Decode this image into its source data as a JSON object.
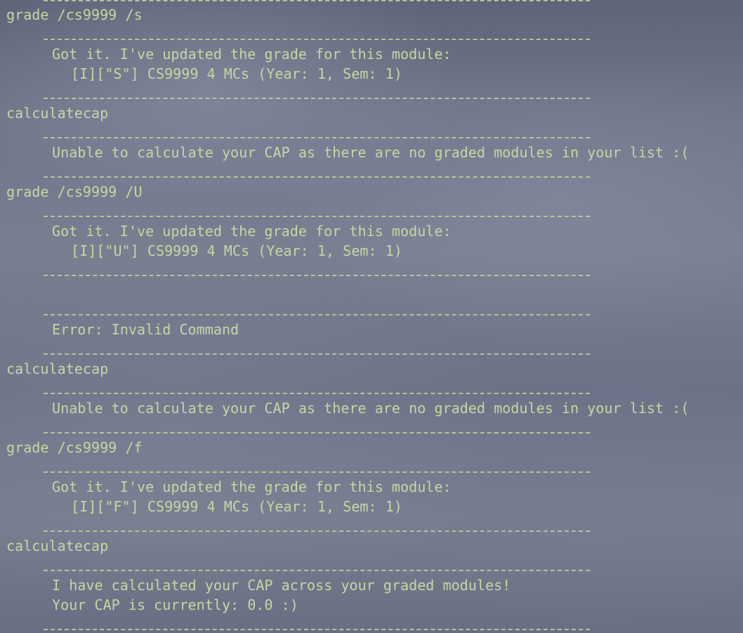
{
  "lines": [
    {
      "id": "l1",
      "kind": "command",
      "text": "grade /cs9999 /s"
    },
    {
      "id": "l2",
      "kind": "response",
      "text": "Got it. I've updated the grade for this module:"
    },
    {
      "id": "l3",
      "kind": "response-detail",
      "text": "[I][\"S\"] CS9999 4 MCs (Year: 1, Sem: 1)"
    },
    {
      "id": "l4",
      "kind": "command",
      "text": "calculatecap"
    },
    {
      "id": "l5",
      "kind": "response",
      "text": "Unable to calculate your CAP as there are no graded modules in your list :("
    },
    {
      "id": "l6",
      "kind": "command",
      "text": "grade /cs9999 /U"
    },
    {
      "id": "l7",
      "kind": "response",
      "text": "Got it. I've updated the grade for this module:"
    },
    {
      "id": "l8",
      "kind": "response-detail",
      "text": "[I][\"U\"] CS9999 4 MCs (Year: 1, Sem: 1)"
    },
    {
      "id": "l9",
      "kind": "response",
      "text": "Error: Invalid Command"
    },
    {
      "id": "l10",
      "kind": "command",
      "text": "calculatecap"
    },
    {
      "id": "l11",
      "kind": "response",
      "text": "Unable to calculate your CAP as there are no graded modules in your list :("
    },
    {
      "id": "l12",
      "kind": "command",
      "text": "grade /cs9999 /f"
    },
    {
      "id": "l13",
      "kind": "response",
      "text": "Got it. I've updated the grade for this module:"
    },
    {
      "id": "l14",
      "kind": "response-detail",
      "text": "[I][\"F\"] CS9999 4 MCs (Year: 1, Sem: 1)"
    },
    {
      "id": "l15",
      "kind": "command",
      "text": "calculatecap"
    },
    {
      "id": "l16",
      "kind": "response",
      "text": "I have calculated your CAP across your graded modules!"
    },
    {
      "id": "l17",
      "kind": "response",
      "text": "Your CAP is currently: 0.0 :)"
    }
  ],
  "colors": {
    "text": "#c6d7a1",
    "rule": "#c0d39c"
  }
}
